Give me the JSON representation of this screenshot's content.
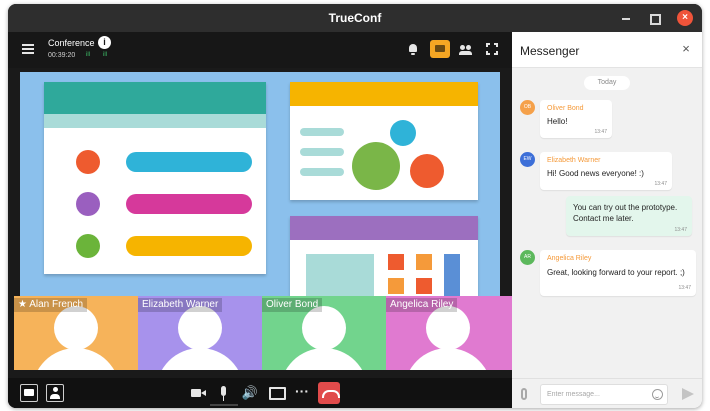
{
  "window": {
    "title": "TrueConf",
    "close_glyph": "×"
  },
  "conference": {
    "title": "Conference",
    "info_glyph": "i",
    "timer": "00:39:20",
    "signal_labels": [
      "ill",
      "ill"
    ]
  },
  "participants": [
    {
      "name": "★ Alan French",
      "color": "#f6b35a"
    },
    {
      "name": "Elizabeth Warner",
      "color": "#a792ec"
    },
    {
      "name": "Oliver Bond",
      "color": "#72d48d"
    },
    {
      "name": "Angelica Riley",
      "color": "#e07ad0"
    }
  ],
  "controls": {
    "speaker_glyph": "🔊",
    "more_glyph": "···"
  },
  "messenger": {
    "title": "Messenger",
    "close_glyph": "×",
    "day_label": "Today",
    "messages": [
      {
        "avatar": "OB",
        "avatar_color": "#f5a14a",
        "sender": "Oliver Bond",
        "sender_color": "#f59a3a",
        "text": [
          "Hello!"
        ],
        "time": "13:47"
      },
      {
        "avatar": "EW",
        "avatar_color": "#3d6fd8",
        "sender": "Elizabeth Warner",
        "sender_color": "#f59a3a",
        "text": [
          "Hi! Good news everyone! :)"
        ],
        "time": "13:47"
      },
      {
        "own": true,
        "text": [
          "You can try out the prototype.",
          "Contact me later."
        ],
        "time": "13:47"
      },
      {
        "avatar": "AR",
        "avatar_color": "#5cb85c",
        "sender": "Angelica Riley",
        "sender_color": "#f59a3a",
        "text": [
          "Great, looking forward to your report. ;)"
        ],
        "time": "13:47"
      }
    ],
    "input_placeholder": "Enter message..."
  },
  "colors": {
    "accent": "#f5a623",
    "hangup": "#e14b4b",
    "shared_screen_bg": "#8bc0ec"
  }
}
